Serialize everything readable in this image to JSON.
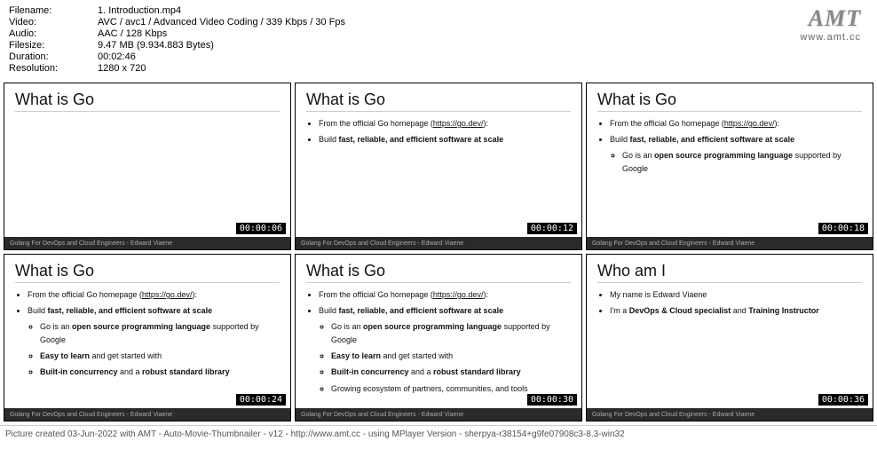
{
  "meta": {
    "filename_label": "Filename:",
    "filename": "1. Introduction.mp4",
    "video_label": "Video:",
    "video": "AVC / avc1 / Advanced Video Coding / 339 Kbps / 30 Fps",
    "audio_label": "Audio:",
    "audio": "AAC / 128 Kbps",
    "filesize_label": "Filesize:",
    "filesize": "9.47 MB (9.934.883 Bytes)",
    "duration_label": "Duration:",
    "duration": "00:02:46",
    "resolution_label": "Resolution:",
    "resolution": "1280 x 720"
  },
  "logo": {
    "text": "AMT",
    "url": "www.amt.cc"
  },
  "slides": {
    "footer_text": "Golang For DevOps and Cloud Engineers - Edward Viaene",
    "ts": [
      "00:00:06",
      "00:00:12",
      "00:00:18",
      "00:00:24",
      "00:00:30",
      "00:00:36"
    ],
    "t1_title": "What is Go",
    "t2_title": "What is Go",
    "t3_title": "What is Go",
    "t4_title": "What is Go",
    "t5_title": "What is Go",
    "t6_title": "Who am I",
    "from_official": "From the official Go homepage (",
    "go_link": "https://go.dev/",
    "close_paren": "):",
    "build_prefix": "Build ",
    "build_bold": "fast, reliable, and efficient software at scale",
    "go_is_prefix": "Go is an ",
    "open_source": "open source programming language",
    "supported_by": " supported by Google",
    "easy_bold": "Easy to learn",
    "easy_suffix": " and get started with",
    "builtin_bold": "Built-in concurrency",
    "builtin_mid": " and a ",
    "robust_bold": "robust standard library",
    "growing": "Growing ecosystem of partners, communities, and tools",
    "name_line": "My name is Edward Viaene",
    "im_prefix": "I'm a ",
    "devops_bold": "DevOps & Cloud specialist",
    "and_text": " and ",
    "training_bold": "Training Instructor"
  },
  "footer": "Picture created 03-Jun-2022 with AMT - Auto-Movie-Thumbnailer - v12 - http://www.amt.cc - using MPlayer Version - sherpya-r38154+g9fe07908c3-8.3-win32"
}
